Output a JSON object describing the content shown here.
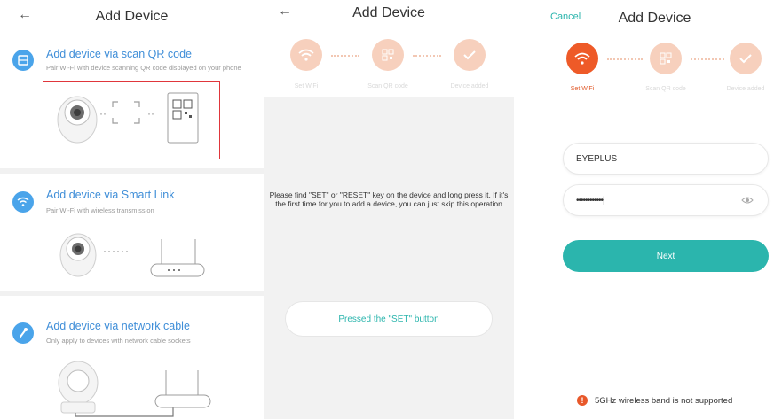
{
  "screen1": {
    "title": "Add Device",
    "options": [
      {
        "title": "Add device via scan QR code",
        "subtitle": "Pair Wi-Fi with device scanning QR code displayed on your phone"
      },
      {
        "title": "Add device via Smart Link",
        "subtitle": "Pair Wi-Fi with wireless transmission"
      },
      {
        "title": "Add device via network cable",
        "subtitle": "Only apply to devices with network cable sockets"
      }
    ],
    "qr_dots": "··",
    "smart_dots": "······"
  },
  "screen2": {
    "title": "Add Device",
    "steps": [
      "Set WiFi",
      "Scan QR code",
      "Device added"
    ],
    "notice": "Please find \"SET\" or \"RESET\" key on the device and long press it. If it's the first time for you to add a device, you can just skip this operation",
    "button": "Pressed the \"SET\" button"
  },
  "screen3": {
    "cancel": "Cancel",
    "title": "Add Device",
    "steps": [
      "Set WiFi",
      "Scan QR code",
      "Device added"
    ],
    "ssid_value": "EYEPLUS",
    "password_value": "••••••••••••|",
    "next": "Next",
    "warning": "5GHz wireless band is not supported",
    "warning_icon": "!"
  },
  "colors": {
    "accent": "#2bb5ad",
    "orange": "#ee5a28",
    "link": "#3f8ed8",
    "qr_highlight": "#e0363b"
  }
}
